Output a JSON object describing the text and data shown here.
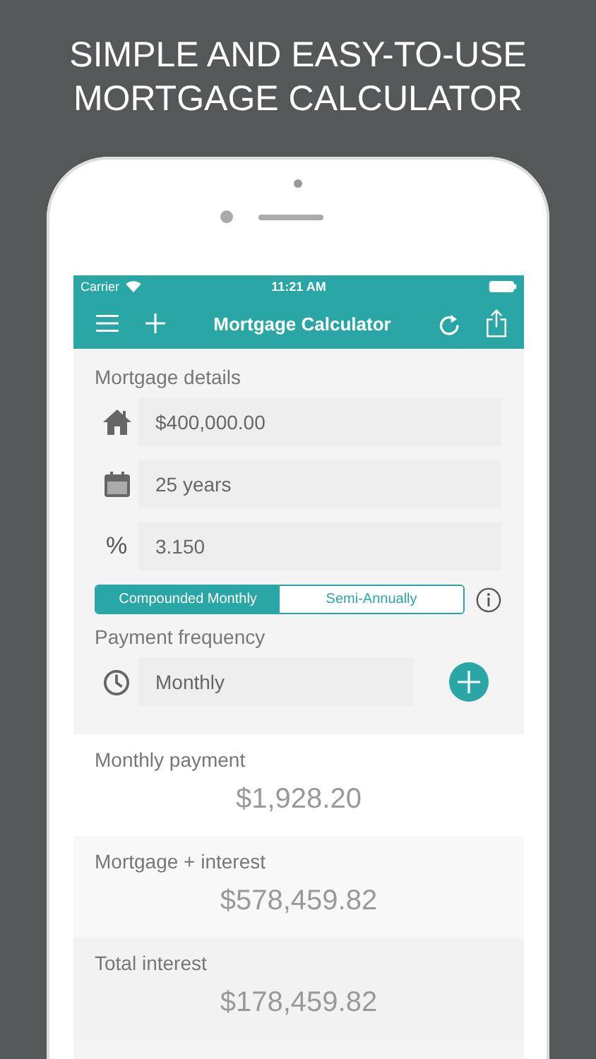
{
  "headline": [
    "SIMPLE AND EASY-TO-USE",
    "MORTGAGE CALCULATOR"
  ],
  "status_bar": {
    "carrier": "Carrier",
    "time": "11:21 AM"
  },
  "nav": {
    "title": "Mortgage Calculator"
  },
  "details": {
    "title": "Mortgage details",
    "fields": [
      {
        "kind": "amount",
        "value": "$400,000.00"
      },
      {
        "kind": "term",
        "value": "25 years"
      },
      {
        "kind": "rate",
        "symbol": "%",
        "value": "3.150"
      }
    ]
  },
  "compounding": [
    {
      "label": "Compounded Monthly",
      "selected": true
    },
    {
      "label": "Semi-Annually",
      "selected": false
    }
  ],
  "payment_frequency": {
    "title": "Payment frequency",
    "value": "Monthly"
  },
  "results": [
    {
      "label": "Monthly payment",
      "value": "$1,928.20"
    },
    {
      "label": "Mortgage + interest",
      "value": "$578,459.82"
    },
    {
      "label": "Total interest",
      "value": "$178,459.82"
    }
  ]
}
